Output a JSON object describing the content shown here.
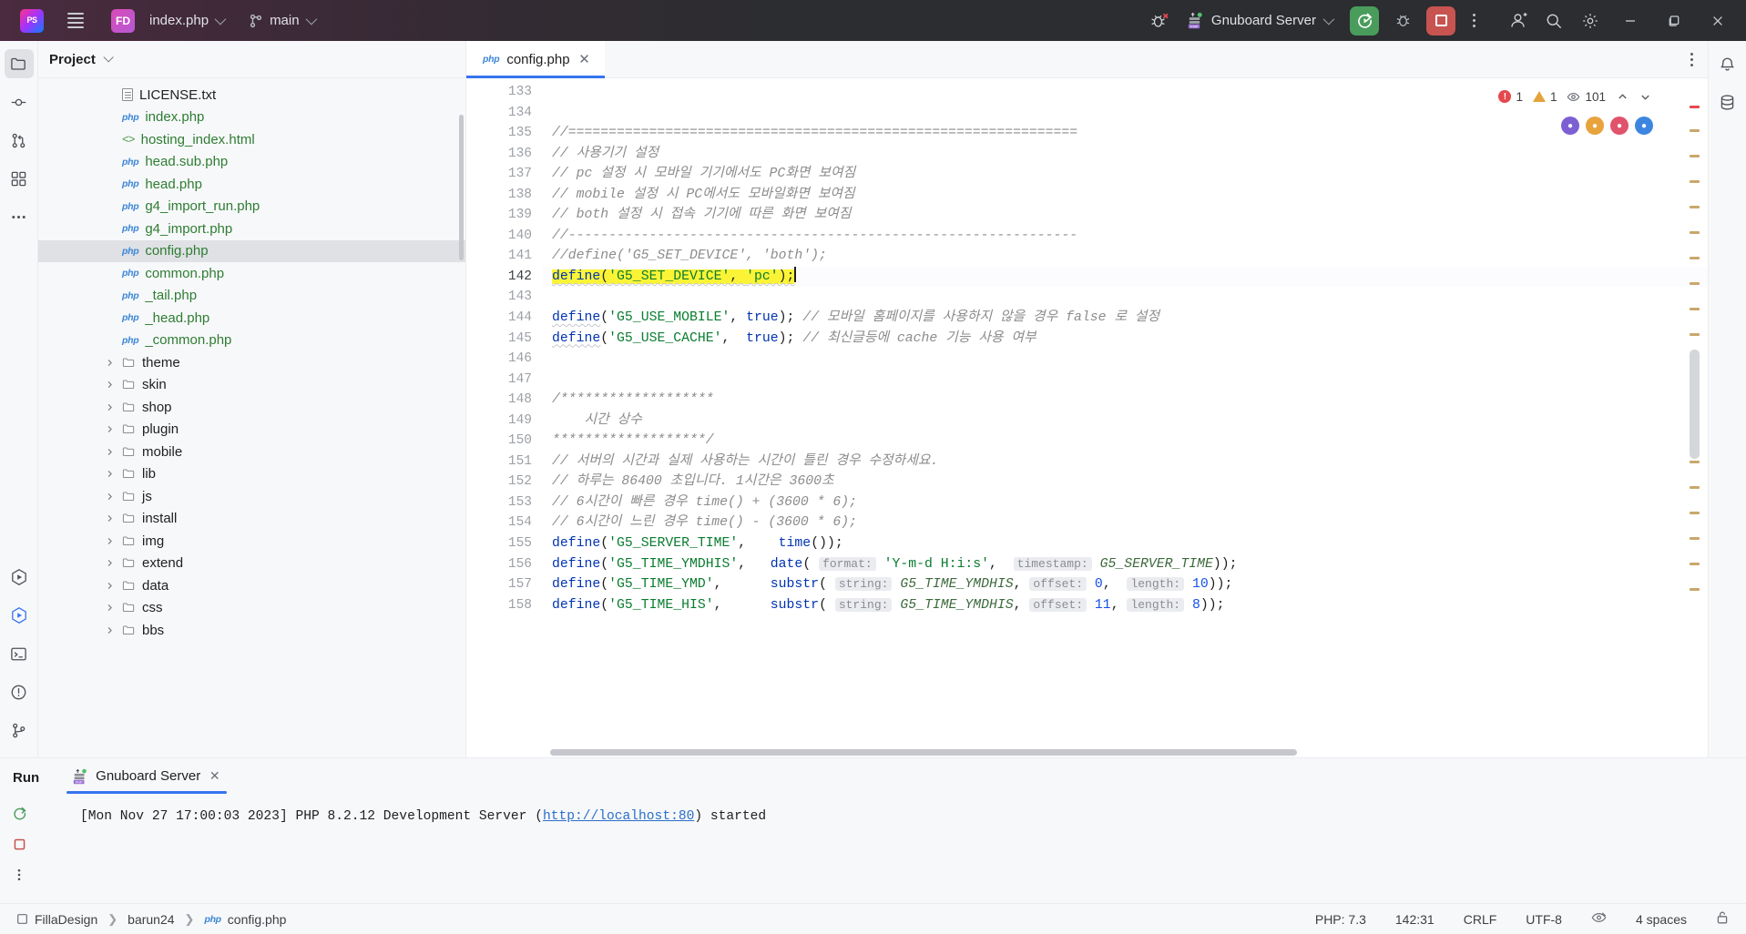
{
  "titlebar": {
    "logo_text": "PS",
    "project_badge": "FD",
    "file_name": "index.php",
    "branch": "main",
    "run_config": "Gnuboard Server",
    "icons": {
      "hamburger": "hamburger-menu-icon",
      "debug": "debug-bug-icon",
      "run": "rerun-icon",
      "debug_run": "debug-icon",
      "stop": "stop-icon",
      "kebab": "more-options-icon",
      "account": "user-account-icon",
      "search": "search-icon",
      "settings": "gear-icon",
      "minimize": "minimize-icon",
      "maximize": "maximize-icon",
      "close": "close-icon"
    }
  },
  "left_rail": {
    "items": [
      {
        "name": "project-tool-icon",
        "active": true
      },
      {
        "name": "commit-tool-icon",
        "active": false
      },
      {
        "name": "pull-requests-icon",
        "active": false
      },
      {
        "name": "structure-icon",
        "active": false
      },
      {
        "name": "more-tool-windows-icon",
        "active": false
      }
    ],
    "bottom_items": [
      {
        "name": "run-tool-icon",
        "active": false
      },
      {
        "name": "debug-tool-icon",
        "active": true
      },
      {
        "name": "terminal-icon",
        "active": false
      },
      {
        "name": "problems-icon",
        "active": false
      },
      {
        "name": "version-control-icon",
        "active": false
      }
    ]
  },
  "right_rail": {
    "items": [
      {
        "name": "notifications-icon"
      },
      {
        "name": "database-icon"
      }
    ]
  },
  "project": {
    "title": "Project",
    "tree": [
      {
        "label": "bbs",
        "type": "folder",
        "indent": 0
      },
      {
        "label": "css",
        "type": "folder",
        "indent": 0
      },
      {
        "label": "data",
        "type": "folder",
        "indent": 0
      },
      {
        "label": "extend",
        "type": "folder",
        "indent": 0
      },
      {
        "label": "img",
        "type": "folder",
        "indent": 0
      },
      {
        "label": "install",
        "type": "folder",
        "indent": 0
      },
      {
        "label": "js",
        "type": "folder",
        "indent": 0
      },
      {
        "label": "lib",
        "type": "folder",
        "indent": 0
      },
      {
        "label": "mobile",
        "type": "folder",
        "indent": 0
      },
      {
        "label": "plugin",
        "type": "folder",
        "indent": 0
      },
      {
        "label": "shop",
        "type": "folder",
        "indent": 0
      },
      {
        "label": "skin",
        "type": "folder",
        "indent": 0
      },
      {
        "label": "theme",
        "type": "folder",
        "indent": 0
      },
      {
        "label": "_common.php",
        "type": "php",
        "indent": 0
      },
      {
        "label": "_head.php",
        "type": "php",
        "indent": 0
      },
      {
        "label": "_tail.php",
        "type": "php",
        "indent": 0
      },
      {
        "label": "common.php",
        "type": "php",
        "indent": 0
      },
      {
        "label": "config.php",
        "type": "php",
        "indent": 0,
        "selected": true
      },
      {
        "label": "g4_import.php",
        "type": "php",
        "indent": 0
      },
      {
        "label": "g4_import_run.php",
        "type": "php",
        "indent": 0
      },
      {
        "label": "head.php",
        "type": "php",
        "indent": 0
      },
      {
        "label": "head.sub.php",
        "type": "php",
        "indent": 0
      },
      {
        "label": "hosting_index.html",
        "type": "html",
        "indent": 0
      },
      {
        "label": "index.php",
        "type": "php",
        "indent": 0
      },
      {
        "label": "LICENSE.txt",
        "type": "txt",
        "indent": 0
      }
    ]
  },
  "editor": {
    "tab_label": "config.php",
    "tab_icon": "php-file-icon",
    "inspection": {
      "errors": "1",
      "warnings": "1",
      "weak_warnings": "101"
    },
    "first_line": 133,
    "lines": [
      {
        "n": 133,
        "html": ""
      },
      {
        "n": 134,
        "html": ""
      },
      {
        "n": 135,
        "html": "<span class=\"cmt\">//===============================================================</span>"
      },
      {
        "n": 136,
        "html": "<span class=\"cmt\">// 사용기기 설정</span>"
      },
      {
        "n": 137,
        "html": "<span class=\"cmt\">// pc 설정 시 모바일 기기에서도 PC화면 보여짐</span>"
      },
      {
        "n": 138,
        "html": "<span class=\"cmt\">// mobile 설정 시 PC에서도 모바일화면 보여짐</span>"
      },
      {
        "n": 139,
        "html": "<span class=\"cmt\">// both 설정 시 접속 기기에 따른 화면 보여짐</span>"
      },
      {
        "n": 140,
        "html": "<span class=\"cmt\">//---------------------------------------------------------------</span>"
      },
      {
        "n": 141,
        "html": "<span class=\"cmt\">//define('G5_SET_DEVICE', 'both');</span>"
      },
      {
        "n": 142,
        "current": true,
        "html": "<span class=\"hl squig\"><span class=\"fn\">define</span>(<span class=\"str\">'G5_SET_DEVICE'</span>, <span class=\"str\">'pc'</span>);</span><span class=\"caret\"></span>"
      },
      {
        "n": 143,
        "html": ""
      },
      {
        "n": 144,
        "html": "<span class=\"fn squig\">define</span>(<span class=\"str\">'G5_USE_MOBILE'</span>, <span class=\"kw\">true</span>); <span class=\"cmt\">// 모바일 홈페이지를 사용하지 않을 경우 false 로 설정</span>"
      },
      {
        "n": 145,
        "html": "<span class=\"fn squig\">define</span>(<span class=\"str\">'G5_USE_CACHE'</span>,  <span class=\"kw\">true</span>); <span class=\"cmt\">// 최신글등에 cache 기능 사용 여부</span>"
      },
      {
        "n": 146,
        "html": ""
      },
      {
        "n": 147,
        "html": ""
      },
      {
        "n": 148,
        "html": "<span class=\"cmt\">/*******************</span>"
      },
      {
        "n": 149,
        "html": "<span class=\"cmt\">    시간 상수</span>"
      },
      {
        "n": 150,
        "html": "<span class=\"cmt\">*******************/</span>"
      },
      {
        "n": 151,
        "html": "<span class=\"cmt\">// 서버의 시간과 실제 사용하는 시간이 틀린 경우 수정하세요.</span>"
      },
      {
        "n": 152,
        "html": "<span class=\"cmt\">// 하루는 86400 초입니다. 1시간은 3600초</span>"
      },
      {
        "n": 153,
        "html": "<span class=\"cmt\">// 6시간이 빠른 경우 time() + (3600 * 6);</span>"
      },
      {
        "n": 154,
        "html": "<span class=\"cmt\">// 6시간이 느린 경우 time() - (3600 * 6);</span>"
      },
      {
        "n": 155,
        "html": "<span class=\"fn\">define</span>(<span class=\"str\">'G5_SERVER_TIME'</span>,    <span class=\"fn\">time</span>());"
      },
      {
        "n": 156,
        "html": "<span class=\"fn\">define</span>(<span class=\"str\">'G5_TIME_YMDHIS'</span>,   <span class=\"fn\">date</span>( <span class=\"hint\">format:</span> <span class=\"str\">'Y-m-d H:i:s'</span>,  <span class=\"hint\">timestamp:</span> <span class=\"hintv\">G5_SERVER_TIME</span>));"
      },
      {
        "n": 157,
        "html": "<span class=\"fn\">define</span>(<span class=\"str\">'G5_TIME_YMD'</span>,      <span class=\"fn\">substr</span>( <span class=\"hint\">string:</span> <span class=\"hintv\">G5_TIME_YMDHIS</span>, <span class=\"hint\">offset:</span> <span class=\"num\">0</span>,  <span class=\"hint\">length:</span> <span class=\"num\">10</span>));"
      },
      {
        "n": 158,
        "html": "<span class=\"fn\">define</span>(<span class=\"str\">'G5_TIME_HIS'</span>,      <span class=\"fn\">substr</span>( <span class=\"hint\">string:</span> <span class=\"hintv\">G5_TIME_YMDHIS</span>, <span class=\"hint\">offset:</span> <span class=\"num\">11</span>, <span class=\"hint\">length:</span> <span class=\"num\">8</span>));"
      }
    ]
  },
  "run_panel": {
    "title": "Run",
    "tab_label": "Gnuboard Server",
    "console_prefix": "[Mon Nov 27 17:00:03 2023] PHP 8.2.12 Development Server (",
    "console_link": "http://localhost:80",
    "console_suffix": ") started",
    "buttons": [
      {
        "name": "rerun-button"
      },
      {
        "name": "stop-button"
      },
      {
        "name": "more-run-options-button"
      }
    ]
  },
  "status_bar": {
    "breadcrumb": [
      {
        "label": "FillaDesign",
        "icon": "module-icon"
      },
      {
        "label": "barun24",
        "icon": null
      },
      {
        "label": "config.php",
        "icon": "php-file-icon"
      }
    ],
    "php_version": "PHP: 7.3",
    "caret_position": "142:31",
    "line_separator": "CRLF",
    "encoding": "UTF-8",
    "indent": "4 spaces",
    "lock_icon": "read-only-lock-icon",
    "inspection_icon": "inspection-eye-icon"
  },
  "colors": {
    "accent": "#3574f0",
    "title_bg": "#2b2d30",
    "run_green": "#4a9c5c",
    "stop_red": "#c75450",
    "highlight_yellow": "#fbf436",
    "error_red": "#e5484d",
    "warn_orange": "#e5a33c"
  }
}
